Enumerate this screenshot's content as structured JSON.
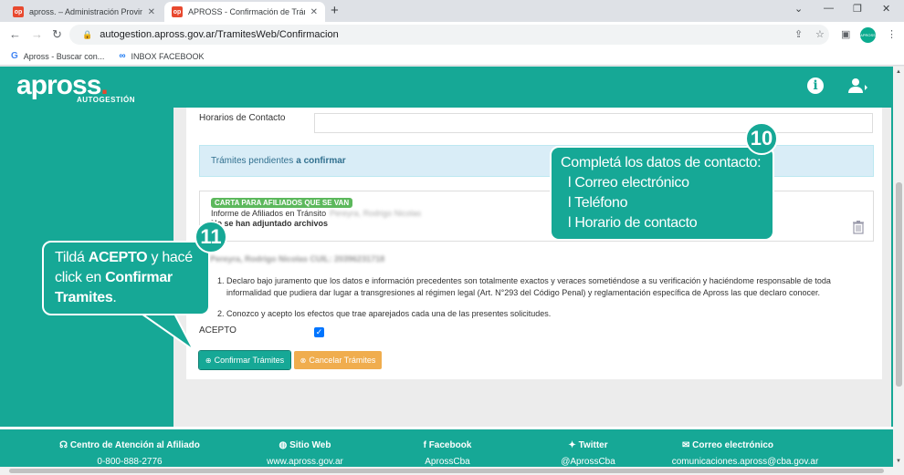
{
  "browser": {
    "tabs": [
      {
        "title": "apross. – Administración Provinc",
        "favicon": "op",
        "active": false
      },
      {
        "title": "APROSS - Confirmación de Trámi",
        "favicon": "op",
        "active": true
      }
    ],
    "url": "autogestion.apross.gov.ar/TramitesWeb/Confirmacion",
    "profile_label": "APROSS",
    "bookmarks": [
      {
        "label": "Apross - Buscar con...",
        "icon": "google-icon"
      },
      {
        "label": "INBOX FACEBOOK",
        "icon": "meta-icon"
      }
    ]
  },
  "header": {
    "logo_text": "apross",
    "logo_dot": ".",
    "logo_sub": "AUTOGESTIÓN"
  },
  "form": {
    "contact_label": "Horarios de Contacto",
    "pending_prefix": "Trámites pendientes",
    "pending_bold": "a confirmar",
    "badge": "CARTA PARA AFILIADOS QUE SE VAN",
    "tramite_title": "Informe de Afiliados en Tránsito",
    "tramite_person": "Pereyra, Rodrigo Nicolas",
    "attachments": "No se han adjuntado archivos",
    "cuil_line": "Pereyra, Rodrigo Nicolas CUIL: 20396231718",
    "declaration_1": "Declaro bajo juramento que los datos e información precedentes son totalmente exactos y veraces sometiéndose a su verificación y haciéndome responsable de toda informalidad que pudiera dar lugar a transgresiones al régimen legal (Art. N°293 del Código Penal) y reglamentación específica de Apross las que declaro conocer.",
    "declaration_2": "Conozco y acepto los efectos que trae aparejados cada una de las presentes solicitudes.",
    "acepto_label": "ACEPTO",
    "confirm_label": "Confirmar Trámites",
    "cancel_label": "Cancelar Trámites"
  },
  "callout_10": {
    "number": "10",
    "line1": "Completá los datos de contacto:",
    "line2": "l Correo electrónico",
    "line3": "l Teléfono",
    "line4": "l Horario de contacto"
  },
  "callout_11": {
    "number": "11",
    "t1": "Tildá ",
    "t2": "ACEPTO",
    "t3": " y hacé click en ",
    "t4": "Confirmar Tramites",
    "t5": "."
  },
  "footer": [
    {
      "title": "Centro de Atención al Afiliado",
      "value": "0-800-888-2776",
      "icon": "headset-icon"
    },
    {
      "title": "Sitio Web",
      "value": "www.apross.gov.ar",
      "icon": "globe-icon"
    },
    {
      "title": "Facebook",
      "value": "AprossCba",
      "icon": "facebook-icon"
    },
    {
      "title": "Twitter",
      "value": "@AprossCba",
      "icon": "twitter-icon"
    },
    {
      "title": "Correo electrónico",
      "value": "comunicaciones.apross@cba.gov.ar",
      "icon": "envelope-icon"
    }
  ],
  "colors": {
    "brand": "#16a896",
    "accent": "#e8492f",
    "cancel": "#f0ad4e",
    "badge": "#5cb85c"
  }
}
